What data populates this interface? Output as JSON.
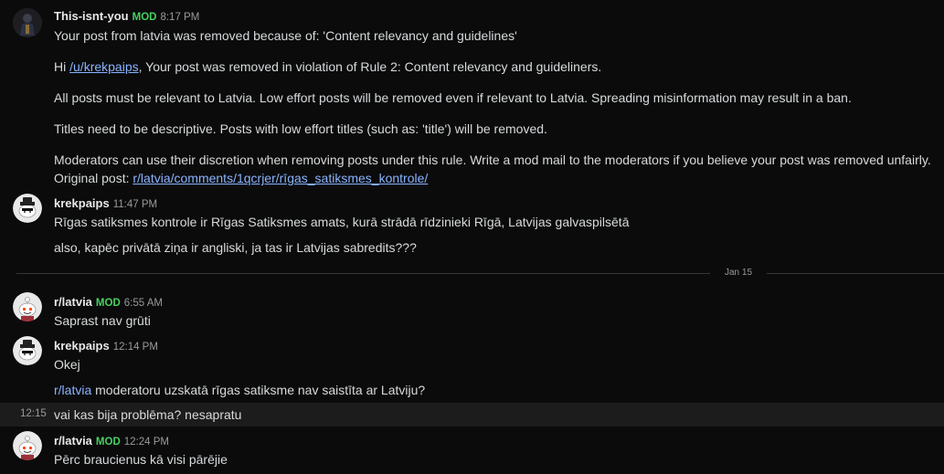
{
  "messages": [
    {
      "author": "This-isnt-you",
      "badge": "MOD",
      "time": "8:17 PM",
      "lines": {
        "l1": "Your post from latvia was removed because of: 'Content relevancy and guidelines'",
        "l2_pre": "Hi ",
        "l2_link": "/u/krekpaips",
        "l2_post": ", Your post was removed in violation of Rule 2: Content relevancy and guideliners.",
        "l3": "All posts must be relevant to Latvia. Low effort posts will be removed even if relevant to Latvia. Spreading misinformation may result in a ban.",
        "l4": "Titles need to be descriptive. Posts with low effort titles (such as: 'title') will be removed.",
        "l5": "Moderators can use their discretion when removing posts under this rule. Write a mod mail to the moderators if you believe your post was removed unfairly.",
        "l6_pre": "Original post: ",
        "l6_link": "r/latvia/comments/1qcrjer/rīgas_satiksmes_kontrole/"
      }
    },
    {
      "author": "krekpaips",
      "time": "11:47 PM",
      "lines": {
        "l1": "Rīgas satiksmes kontrole ir Rīgas Satiksmes amats, kurā strādā rīdzinieki Rīgā, Latvijas galvaspilsētā",
        "l2": "also, kapēc privātā ziņa ir angliski, ja tas ir Latvijas sabredits???"
      }
    },
    {
      "author": "r/latvia",
      "badge": "MOD",
      "time": "6:55 AM",
      "lines": {
        "l1": "Saprast nav grūti"
      }
    },
    {
      "author": "krekpaips",
      "time": "12:14 PM",
      "lines": {
        "l1": "Okej",
        "l2_link": "r/latvia",
        "l2_post": " moderatoru uzskatā rīgas satiksme nav saistīta ar Latviju?"
      },
      "followup": {
        "time": "12:15",
        "text": "vai kas bija problēma? nesapratu"
      }
    },
    {
      "author": "r/latvia",
      "badge": "MOD",
      "time": "12:24 PM",
      "lines": {
        "l1": "Pērc braucienus kā visi pārējie"
      }
    }
  ],
  "date_divider": "Jan 15",
  "colors": {
    "mod_badge": "#46d160",
    "link": "#8ab4ff",
    "background": "#0b0b0b"
  },
  "icons": [
    "avatar-mod-user",
    "avatar-snoo-hat",
    "avatar-snoo"
  ]
}
